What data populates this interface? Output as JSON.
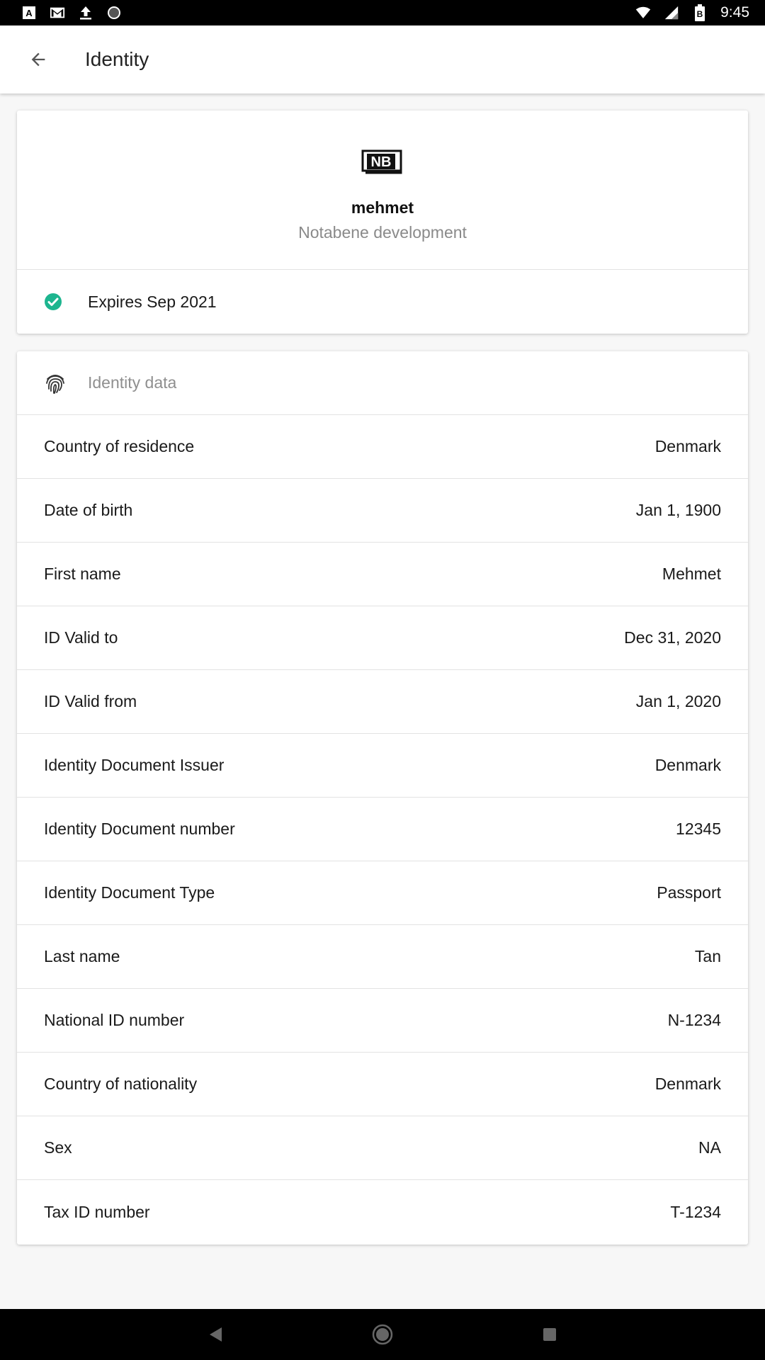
{
  "status_bar": {
    "time": "9:45",
    "left_icons": [
      "text-a-icon",
      "gmail-icon",
      "upload-icon",
      "record-icon"
    ],
    "right_icons": [
      "wifi-icon",
      "signal-icon",
      "battery-icon"
    ],
    "battery_text": "B"
  },
  "app_bar": {
    "title": "Identity",
    "back_icon": "arrow-back-icon"
  },
  "profile_card": {
    "logo_text": "NB",
    "user_name": "mehmet",
    "organization": "Notabene development",
    "status_icon": "check-circle-icon",
    "status_color": "#1db58f",
    "expires_text": "Expires Sep 2021"
  },
  "identity_data": {
    "header_icon": "fingerprint-icon",
    "header_label": "Identity data",
    "rows": [
      {
        "label": "Country of residence",
        "value": "Denmark"
      },
      {
        "label": "Date of birth",
        "value": "Jan 1, 1900"
      },
      {
        "label": "First name",
        "value": "Mehmet"
      },
      {
        "label": "ID Valid to",
        "value": "Dec 31, 2020"
      },
      {
        "label": "ID Valid from",
        "value": "Jan 1, 2020"
      },
      {
        "label": "Identity Document Issuer",
        "value": "Denmark"
      },
      {
        "label": "Identity Document number",
        "value": "12345"
      },
      {
        "label": "Identity Document Type",
        "value": "Passport"
      },
      {
        "label": "Last name",
        "value": "Tan"
      },
      {
        "label": "National ID number",
        "value": "N-1234"
      },
      {
        "label": "Country of nationality",
        "value": "Denmark"
      },
      {
        "label": "Sex",
        "value": "NA"
      },
      {
        "label": "Tax ID number",
        "value": "T-1234"
      }
    ]
  },
  "nav_bar": {
    "icons": [
      "nav-back-icon",
      "nav-home-icon",
      "nav-recents-icon"
    ]
  }
}
